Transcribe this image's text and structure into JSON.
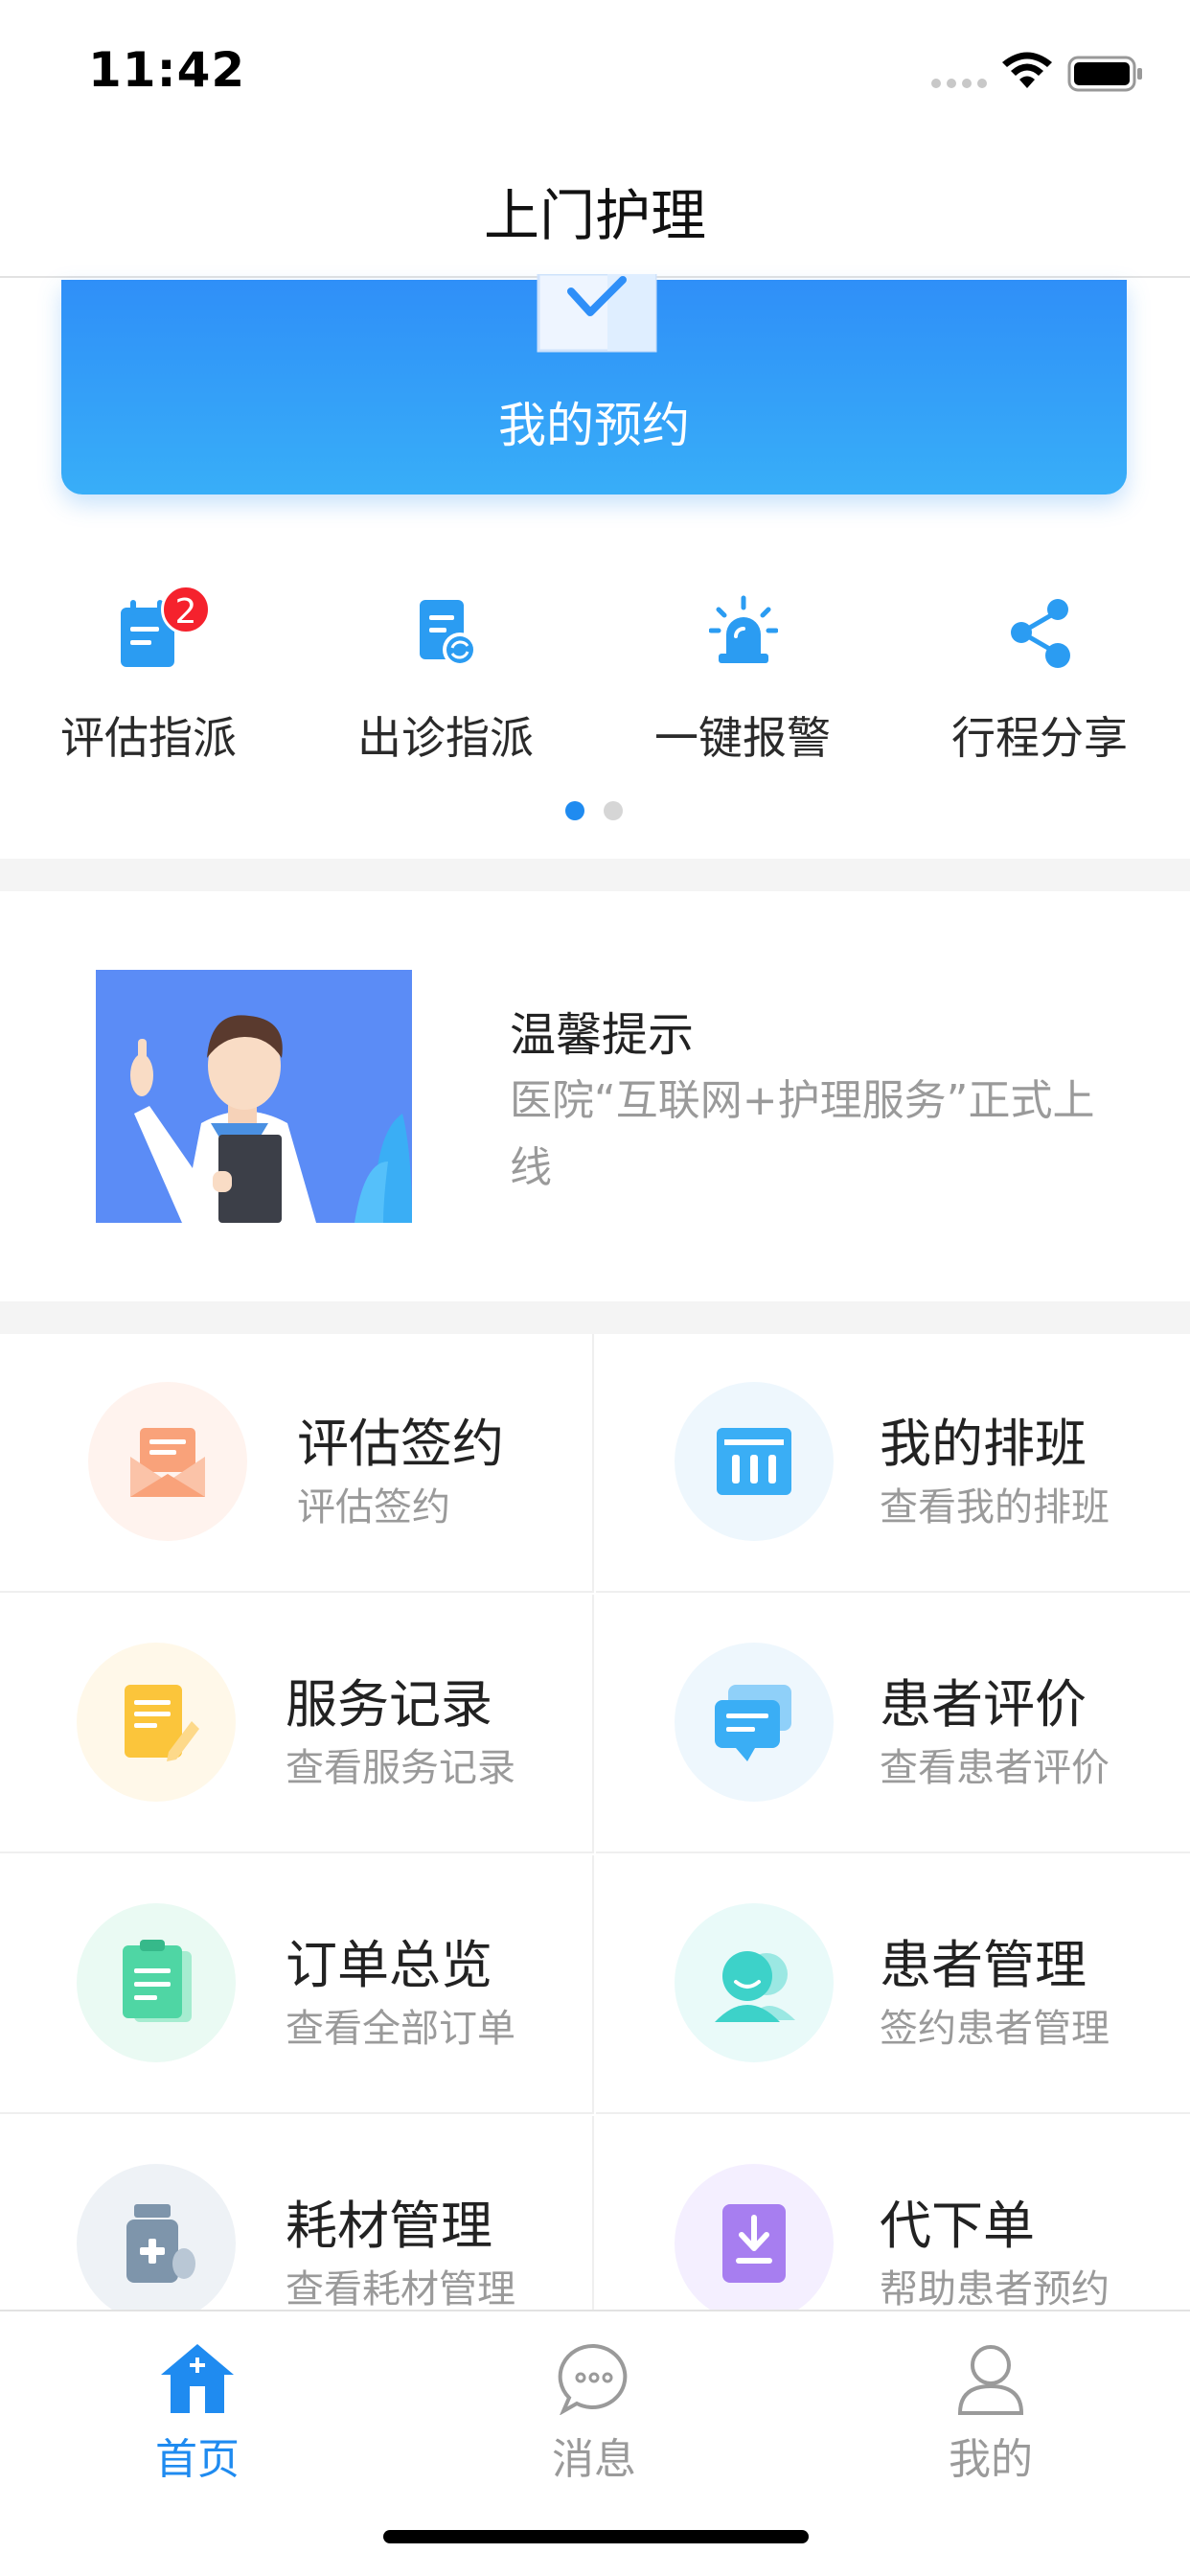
{
  "status_bar": {
    "time": "11:42"
  },
  "nav": {
    "title": "上门护理"
  },
  "appointment": {
    "label": "我的预约"
  },
  "quick_actions": [
    {
      "label": "评估指派",
      "icon": "calendar-note-icon",
      "badge": "2"
    },
    {
      "label": "出诊指派",
      "icon": "document-refresh-icon"
    },
    {
      "label": "一键报警",
      "icon": "alarm-siren-icon"
    },
    {
      "label": "行程分享",
      "icon": "share-icon"
    }
  ],
  "pager": {
    "pages": 2,
    "active": 1
  },
  "notice": {
    "title": "温馨提示",
    "body": "医院“互联网+护理服务”正式上线"
  },
  "grid": [
    {
      "title": "评估签约",
      "subtitle": "评估签约",
      "icon": "envelope-icon",
      "color": "#f9a27a",
      "bg": "#fff3ee"
    },
    {
      "title": "我的排班",
      "subtitle": "查看我的排班",
      "icon": "schedule-icon",
      "color": "#3aaef5",
      "bg": "#eef7fd"
    },
    {
      "title": "服务记录",
      "subtitle": "查看服务记录",
      "icon": "note-edit-icon",
      "color": "#fbc53b",
      "bg": "#fff8e9"
    },
    {
      "title": "患者评价",
      "subtitle": "查看患者评价",
      "icon": "chat-bubbles-icon",
      "color": "#3aaef5",
      "bg": "#eef7fd"
    },
    {
      "title": "订单总览",
      "subtitle": "查看全部订单",
      "icon": "clipboard-icon",
      "color": "#4fd6a4",
      "bg": "#eafaf3"
    },
    {
      "title": "患者管理",
      "subtitle": "签约患者管理",
      "icon": "patients-icon",
      "color": "#3dd2c9",
      "bg": "#e9faf9"
    },
    {
      "title": "耗材管理",
      "subtitle": "查看耗材管理",
      "icon": "medicine-bottle-icon",
      "color": "#7e95ab",
      "bg": "#eef2f6"
    },
    {
      "title": "代下单",
      "subtitle": "帮助患者预约",
      "icon": "download-doc-icon",
      "color": "#a77ef0",
      "bg": "#f4efff"
    }
  ],
  "tabs": [
    {
      "label": "首页",
      "icon": "home-icon",
      "active": true
    },
    {
      "label": "消息",
      "icon": "message-icon",
      "active": false
    },
    {
      "label": "我的",
      "icon": "profile-icon",
      "active": false
    }
  ],
  "colors": {
    "accent": "#1f8bf0",
    "tab_inactive": "#9a9a9a",
    "badge": "#f5222d"
  }
}
